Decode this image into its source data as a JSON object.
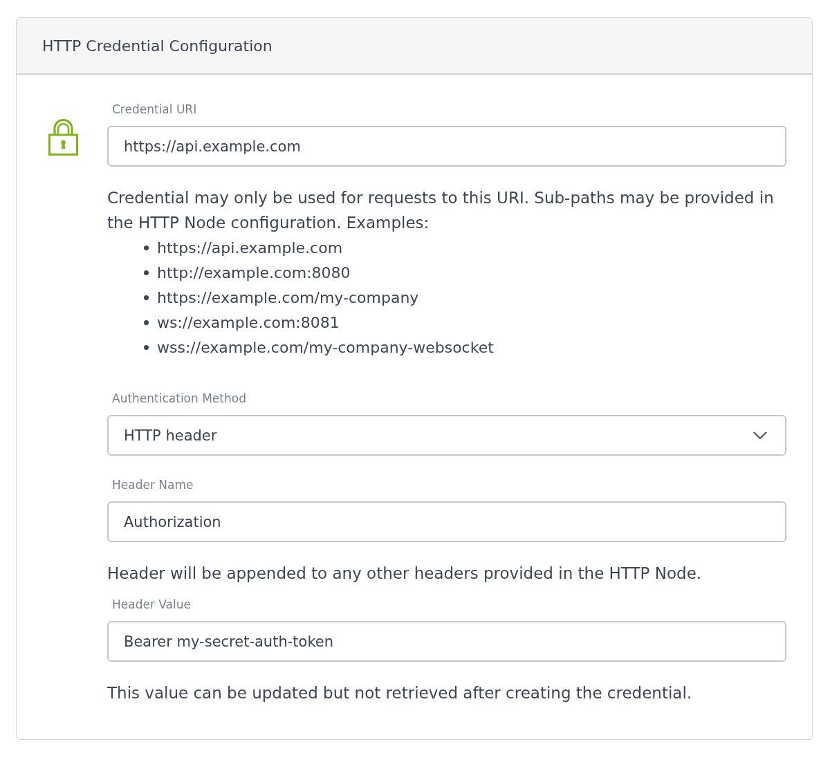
{
  "panel": {
    "title": "HTTP Credential Configuration"
  },
  "fields": [
    {
      "kind": "text",
      "label": "Credential URI",
      "value": "https://api.example.com",
      "help": "Credential may only be used for requests to this URI. Sub-paths may be provided in the HTTP Node configuration. Examples:",
      "examples": [
        "https://api.example.com",
        "http://example.com:8080",
        "https://example.com/my-company",
        "ws://example.com:8081",
        "wss://example.com/my-company-websocket"
      ]
    },
    {
      "kind": "select",
      "label": "Authentication Method",
      "value": "HTTP header"
    },
    {
      "kind": "text",
      "label": "Header Name",
      "value": "Authorization",
      "help": "Header will be appended to any other headers provided in the HTTP Node."
    },
    {
      "kind": "text",
      "label": "Header Value",
      "value": "Bearer my-secret-auth-token",
      "help": "This value can be updated but not retrieved after creating the credential."
    }
  ]
}
